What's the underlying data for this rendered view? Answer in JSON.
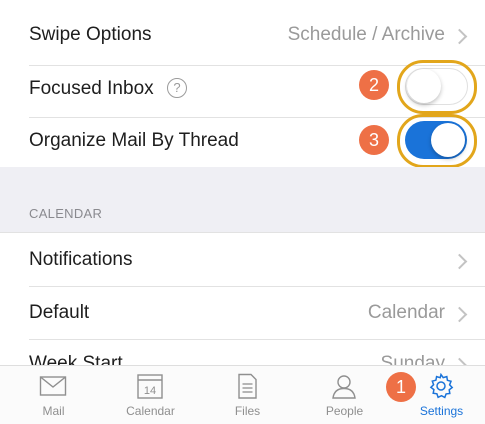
{
  "rows": {
    "swipe_options": {
      "label": "Swipe Options",
      "value": "Schedule / Archive"
    },
    "focused_inbox": {
      "label": "Focused Inbox",
      "help": "?",
      "enabled": false
    },
    "organize_by_thread": {
      "label": "Organize Mail By Thread",
      "enabled": true
    }
  },
  "calendar_section": {
    "header": "CALENDAR",
    "notifications": {
      "label": "Notifications"
    },
    "default": {
      "label": "Default",
      "value": "Calendar"
    },
    "week_start": {
      "label": "Week Start",
      "value": "Sunday"
    }
  },
  "annotations": {
    "badge_1": "1",
    "badge_2": "2",
    "badge_3": "3",
    "ring_color": "#e2a61b",
    "badge_color": "#ee7046"
  },
  "tabbar": {
    "tabs": [
      {
        "label": "Mail",
        "icon": "mail-icon"
      },
      {
        "label": "Calendar",
        "icon": "calendar-icon",
        "date": "14"
      },
      {
        "label": "Files",
        "icon": "files-icon"
      },
      {
        "label": "People",
        "icon": "people-icon"
      },
      {
        "label": "Settings",
        "icon": "gear-icon",
        "active": true
      }
    ]
  },
  "colors": {
    "accent": "#1a73d9",
    "toggle_on": "#1a73d9",
    "toggle_off": "#ffffff"
  }
}
